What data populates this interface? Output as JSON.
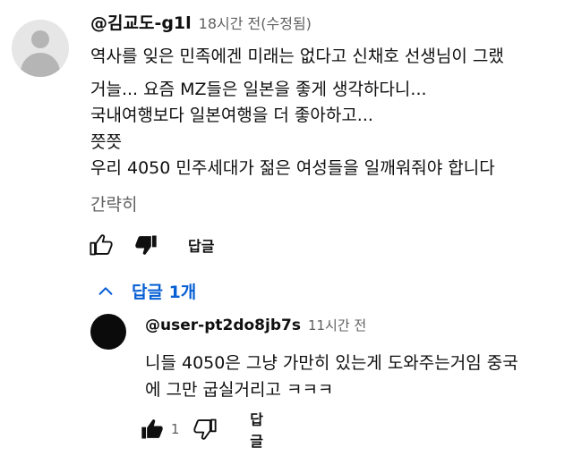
{
  "comment": {
    "author": "@김교도-g1l",
    "time": "18시간 전(수정됨)",
    "lines": [
      "역사를 잊은 민족에겐 미래는 없다고 신채호 선생님이 그랬",
      "거늘... 요즘 MZ들은 일본을 좋게 생각하다니...",
      "국내여행보다 일본여행을 더 좋아하고...",
      "쯧쯧",
      "우리 4050 민주세대가 젊은 여성들을 일깨워줘야 합니다"
    ],
    "collapse_label": "간략히",
    "reply_label": "답글"
  },
  "replies_toggle": {
    "label": "답글 1개"
  },
  "reply": {
    "author": "@user-pt2do8jb7s",
    "time": "11시간 전",
    "lines": [
      "니들 4050은 그냥 가만히 있는게 도와주는거임 중국",
      "에 그만 굽실거리고 ㅋㅋㅋ"
    ],
    "like_count": "1",
    "reply_label": "답글"
  },
  "icons": {
    "like": "thumbs-up-icon",
    "dislike": "thumbs-down-icon",
    "chevron": "chevron-up-icon",
    "accent_color": "#065fd4"
  }
}
